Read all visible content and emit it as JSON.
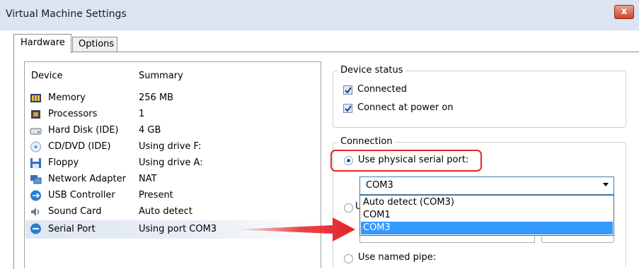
{
  "window": {
    "title": "Virtual Machine Settings",
    "close_glyph": "x"
  },
  "tabs": [
    {
      "label": "Hardware",
      "active": true
    },
    {
      "label": "Options",
      "active": false
    }
  ],
  "device_list": {
    "headers": {
      "device": "Device",
      "summary": "Summary"
    },
    "rows": [
      {
        "name": "Memory",
        "summary": "256 MB",
        "icon": "memory-icon"
      },
      {
        "name": "Processors",
        "summary": "1",
        "icon": "processor-icon"
      },
      {
        "name": "Hard Disk (IDE)",
        "summary": "4 GB",
        "icon": "hard-disk-icon"
      },
      {
        "name": "CD/DVD (IDE)",
        "summary": "Using drive F:",
        "icon": "cd-dvd-icon"
      },
      {
        "name": "Floppy",
        "summary": "Using drive A:",
        "icon": "floppy-icon"
      },
      {
        "name": "Network Adapter",
        "summary": "NAT",
        "icon": "network-adapter-icon"
      },
      {
        "name": "USB Controller",
        "summary": "Present",
        "icon": "usb-icon"
      },
      {
        "name": "Sound Card",
        "summary": "Auto detect",
        "icon": "sound-card-icon"
      },
      {
        "name": "Serial Port",
        "summary": "Using port COM3",
        "icon": "serial-port-icon",
        "selected": true
      }
    ]
  },
  "device_status": {
    "title": "Device status",
    "connected": {
      "label": "Connected",
      "checked": true
    },
    "connect_at_power_on": {
      "label": "Connect at power on",
      "checked": true
    }
  },
  "connection": {
    "title": "Connection",
    "physical_port": {
      "label": "Use physical serial port:",
      "selected": true
    },
    "port_select": {
      "value": "COM3",
      "options": [
        "Auto detect (COM3)",
        "COM1",
        "COM3"
      ],
      "highlighted": "COM3"
    },
    "second_option_partial": "U",
    "named_pipe": {
      "label": "Use named pipe:",
      "selected": false
    }
  },
  "colors": {
    "annotation_red": "#e4242a",
    "selection_blue": "#3399ff"
  }
}
